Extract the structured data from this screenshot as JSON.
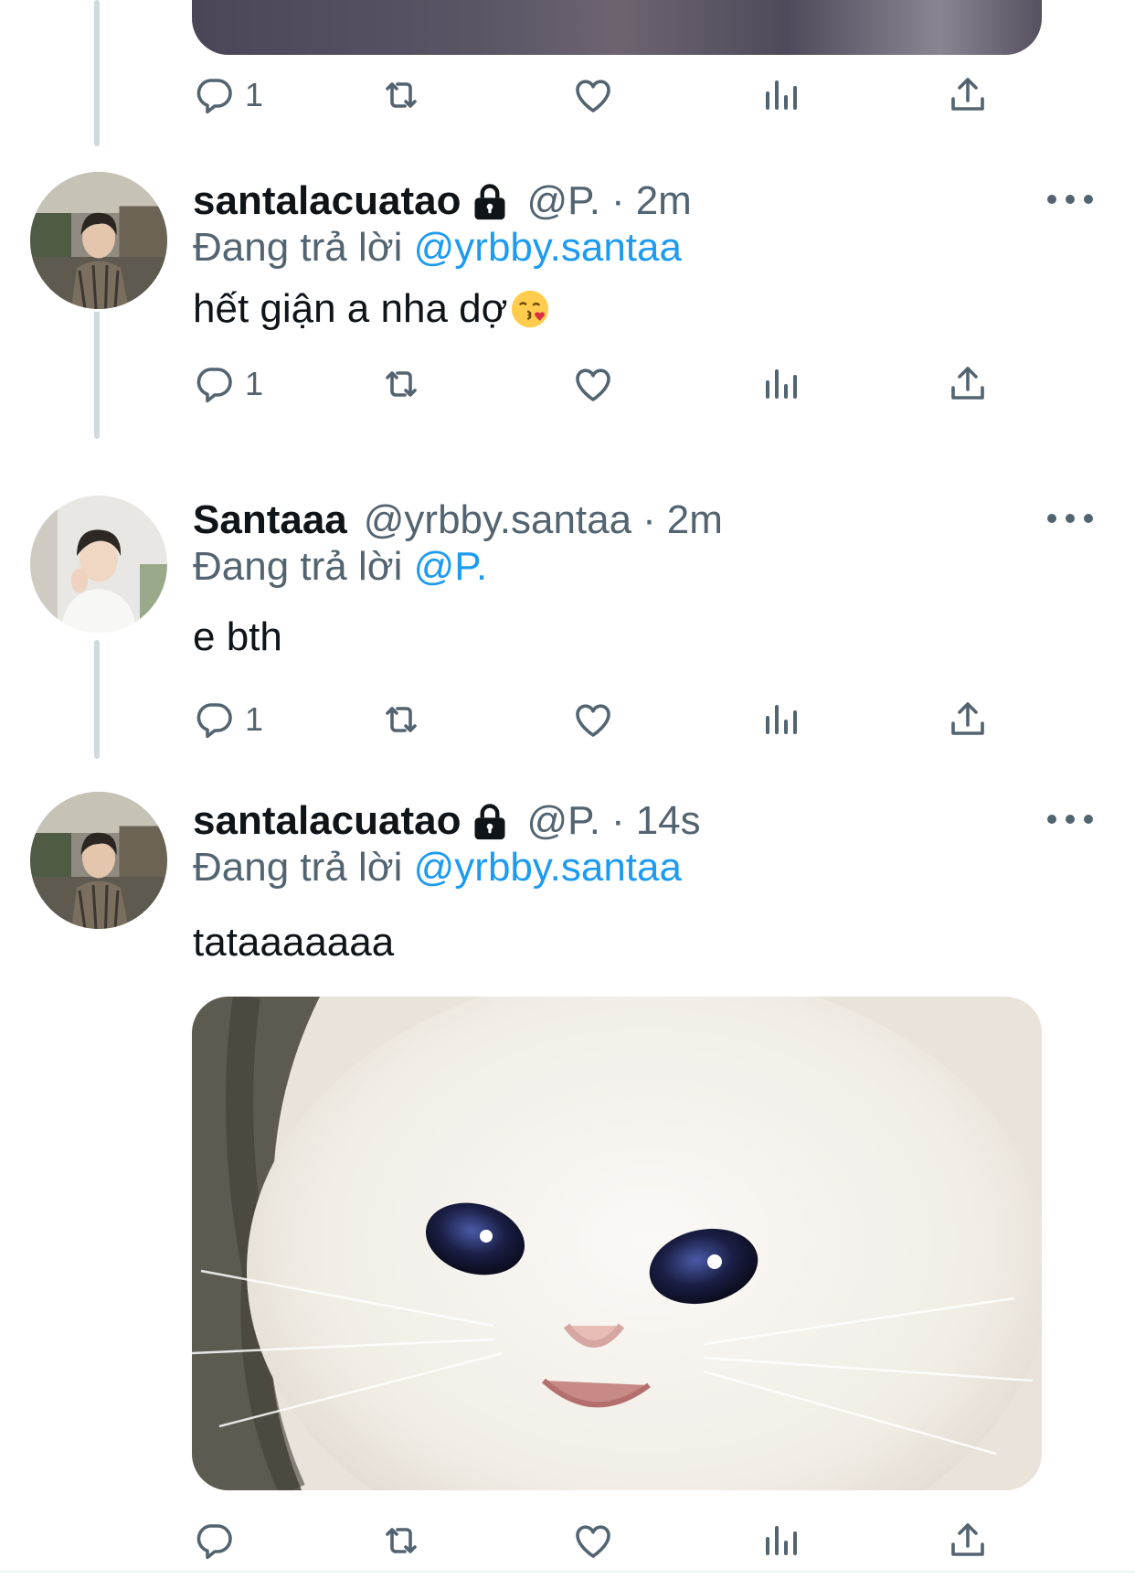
{
  "tweets": [
    {
      "name": "santalacuatao",
      "protected": true,
      "handle": "@P.",
      "separator": "·",
      "time": "2m",
      "replying_prefix": "Đang trả lời ",
      "replying_to": "@yrbby.santaa",
      "text": "hết giận a nha dợ",
      "emoji": "face-blowing-a-kiss",
      "reply_count": "1"
    },
    {
      "name": "Santaaa",
      "protected": false,
      "handle": "@yrbby.santaa",
      "separator": "·",
      "time": "2m",
      "replying_prefix": "Đang trả lời ",
      "replying_to": "@P.",
      "text": "e bth",
      "reply_count": "1"
    },
    {
      "name": "santalacuatao",
      "protected": true,
      "handle": "@P.",
      "separator": "·",
      "time": "14s",
      "replying_prefix": "Đang trả lời ",
      "replying_to": "@yrbby.santaa",
      "text": "tataaaaaaa",
      "reply_count": ""
    }
  ],
  "top_actions": {
    "reply_count": "1"
  },
  "icons": [
    "reply-icon",
    "retweet-icon",
    "like-icon",
    "views-icon",
    "share-icon",
    "more-icon",
    "lock-icon"
  ],
  "colors": {
    "link": "#1d9bf0",
    "secondary": "#536471",
    "text": "#0f1419",
    "thread": "#cfd9de"
  }
}
